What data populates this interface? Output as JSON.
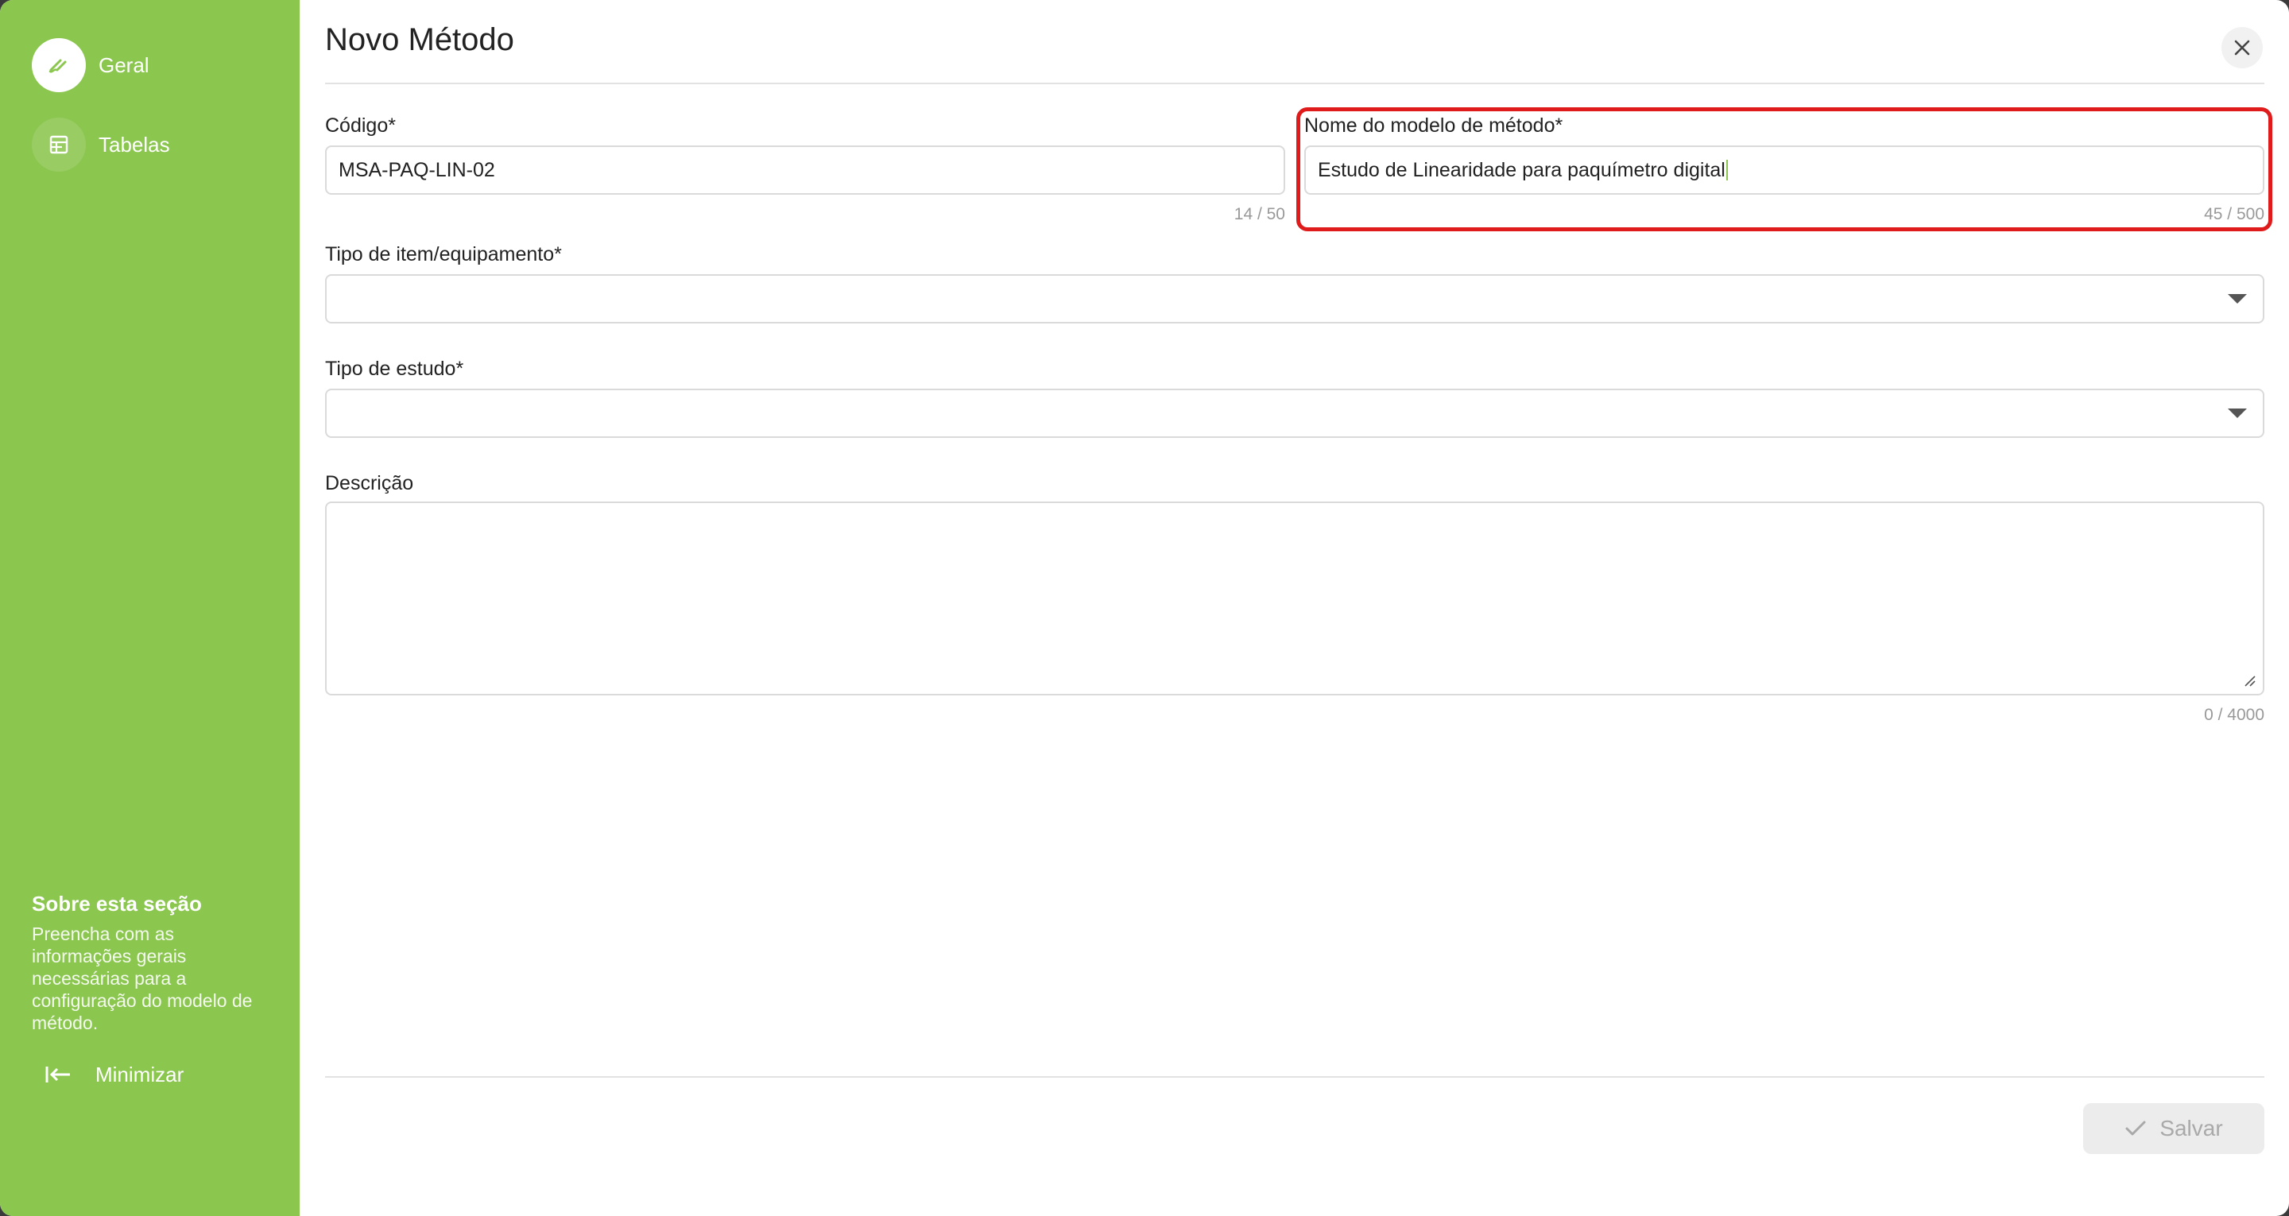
{
  "sidebar": {
    "items": [
      {
        "label": "Geral",
        "icon": "pen-icon"
      },
      {
        "label": "Tabelas",
        "icon": "table-icon"
      }
    ],
    "about_title": "Sobre esta seção",
    "about_text": "Preencha com as informações gerais necessárias para a configuração do modelo de método.",
    "minimize_label": "Minimizar"
  },
  "dialog": {
    "title": "Novo Método",
    "save_label": "Salvar"
  },
  "form": {
    "codigo": {
      "label": "Código*",
      "value": "MSA-PAQ-LIN-02",
      "counter": "14 / 50"
    },
    "nome": {
      "label": "Nome do modelo de método*",
      "value": "Estudo de Linearidade para paquímetro digital",
      "counter": "45 / 500"
    },
    "tipo_item": {
      "label": "Tipo de item/equipamento*",
      "value": ""
    },
    "tipo_estudo": {
      "label": "Tipo de estudo*",
      "value": ""
    },
    "descricao": {
      "label": "Descrição",
      "value": "",
      "counter": "0 / 4000"
    }
  },
  "colors": {
    "accent": "#8bc64f",
    "highlight": "#e01b1b"
  }
}
